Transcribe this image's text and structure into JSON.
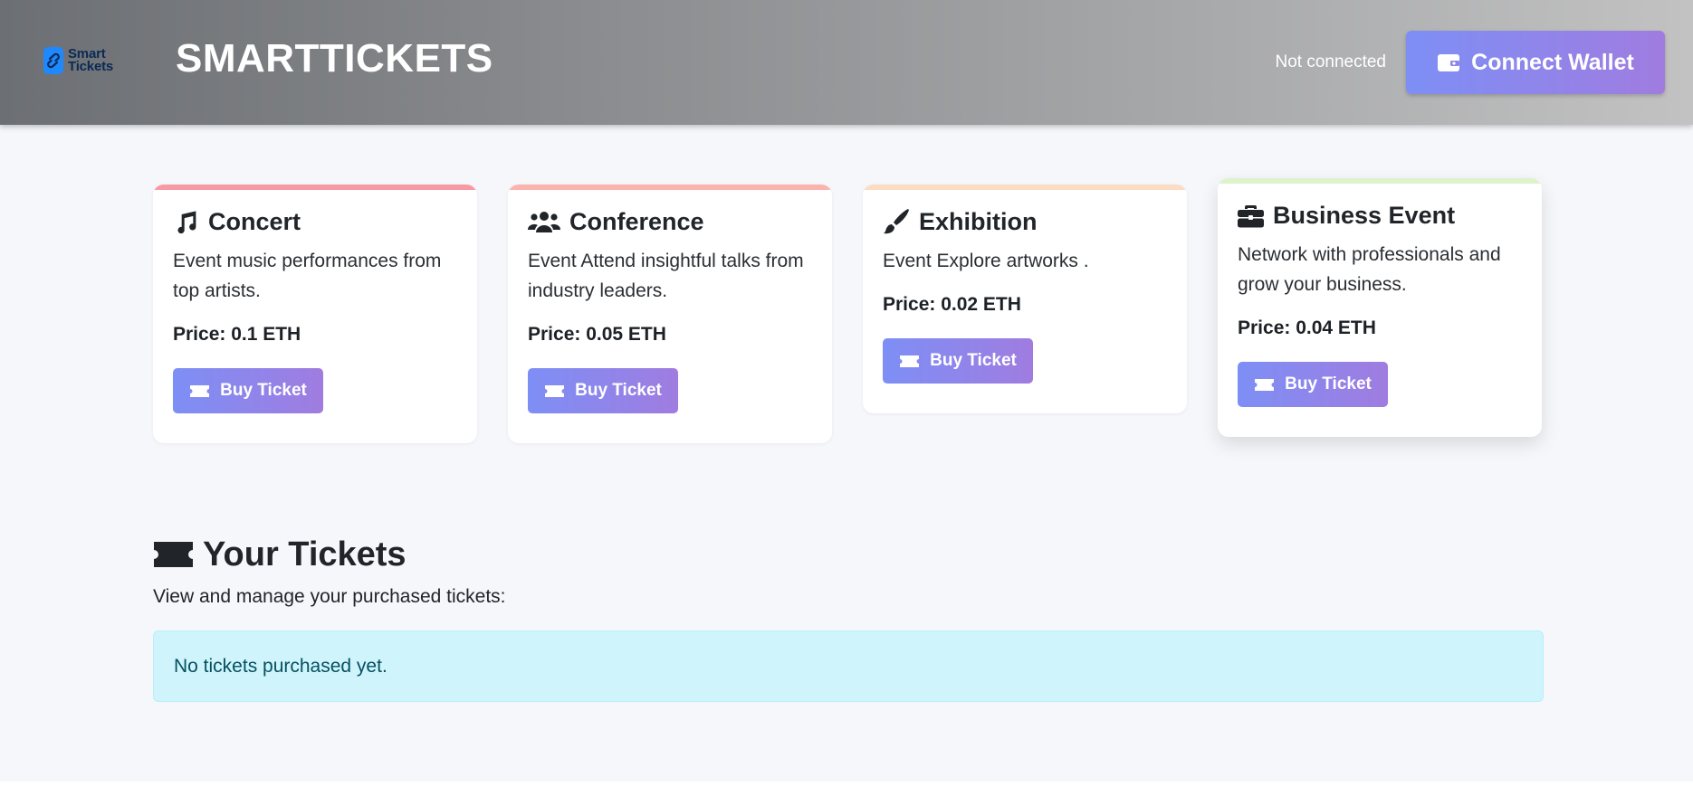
{
  "header": {
    "logo": {
      "icon": "link-icon",
      "line1": "Smart",
      "line2": "Tickets"
    },
    "title": "SMARTTICKETS",
    "status": "Not connected",
    "connect_button": {
      "label": "Connect Wallet",
      "icon": "wallet-icon"
    }
  },
  "events": [
    {
      "icon": "music-note-icon",
      "title": "Concert",
      "description": "Event music performances from top artists.",
      "price": "Price: 0.1 ETH",
      "button": "Buy Ticket",
      "accent": "#f89aa3"
    },
    {
      "icon": "users-icon",
      "title": "Conference",
      "description": "Event Attend insightful talks from industry leaders.",
      "price": "Price: 0.05 ETH",
      "button": "Buy Ticket",
      "accent": "#fbb3ae"
    },
    {
      "icon": "paintbrush-icon",
      "title": "Exhibition",
      "description": "Event Explore artworks .",
      "price": "Price: 0.02 ETH",
      "button": "Buy Ticket",
      "accent": "#fcdcc2"
    },
    {
      "icon": "briefcase-icon",
      "title": "Business Event",
      "description": "Network with professionals and grow your business.",
      "price": "Price: 0.04 ETH",
      "button": "Buy Ticket",
      "accent": "#def2cc"
    }
  ],
  "tickets": {
    "icon": "ticket-icon",
    "title": "Your Tickets",
    "subtitle": "View and manage your purchased tickets:",
    "empty_message": "No tickets purchased yet."
  },
  "colors": {
    "button_gradient_start": "#7d8ff5",
    "button_gradient_end": "#a07ce0",
    "alert_bg": "#cff4fc",
    "alert_text": "#055160"
  }
}
